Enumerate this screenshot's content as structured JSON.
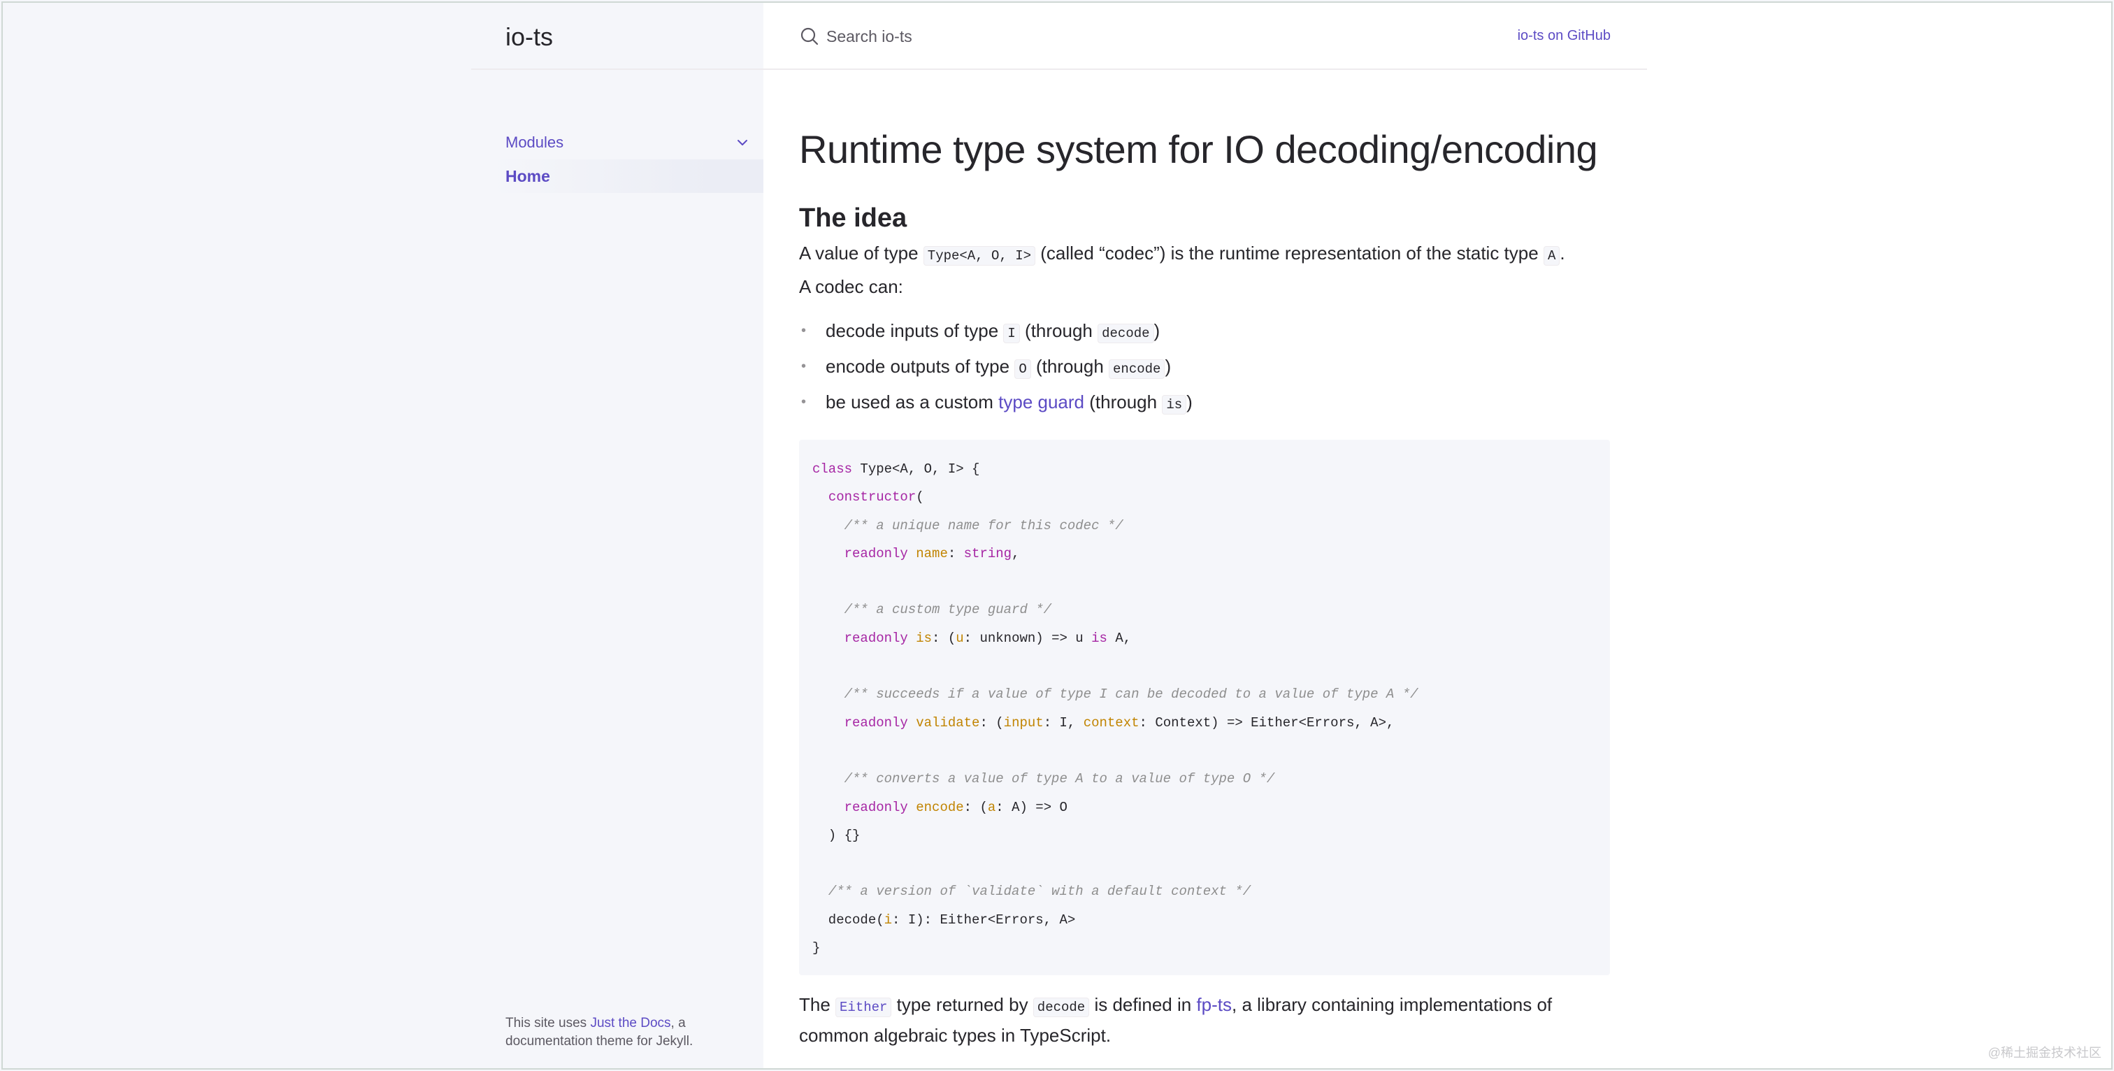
{
  "site": {
    "title": "io-ts"
  },
  "sidebar": {
    "items": [
      {
        "label": "Modules",
        "expanded": true
      },
      {
        "label": "Home",
        "active": true
      }
    ],
    "footer_prefix": "This site uses ",
    "footer_link": "Just the Docs",
    "footer_suffix": ", a documentation theme for Jekyll."
  },
  "header": {
    "search_placeholder": "Search io-ts",
    "github_link": "io-ts on GitHub"
  },
  "main": {
    "title": "Runtime type system for IO decoding/encoding",
    "section_title": "The idea",
    "intro": {
      "t1": "A value of type ",
      "code1": "Type<A, O, I>",
      "t2": " (called “codec”) is the runtime representation of the static type ",
      "code2": "A",
      "t3": "."
    },
    "codec_can": "A codec can:",
    "capabilities": [
      {
        "t1": "decode inputs of type ",
        "code1": "I",
        "t2": " (through ",
        "code2": "decode",
        "t3": ")"
      },
      {
        "t1": "encode outputs of type ",
        "code1": "O",
        "t2": " (through ",
        "code2": "encode",
        "t3": ")"
      },
      {
        "t1": "be used as a custom ",
        "link": "type guard",
        "t2": " (through ",
        "code2": "is",
        "t3": ")"
      }
    ],
    "code_block": [
      [
        {
          "c": "kw",
          "t": "class"
        },
        {
          "c": "pl",
          "t": " Type<A, O, I> {"
        }
      ],
      [
        {
          "c": "pl",
          "t": "  "
        },
        {
          "c": "kw",
          "t": "constructor"
        },
        {
          "c": "pl",
          "t": "("
        }
      ],
      [
        {
          "c": "pl",
          "t": "    "
        },
        {
          "c": "cm",
          "t": "/** a unique name for this codec */"
        }
      ],
      [
        {
          "c": "pl",
          "t": "    "
        },
        {
          "c": "kw",
          "t": "readonly"
        },
        {
          "c": "pl",
          "t": " "
        },
        {
          "c": "prop",
          "t": "name"
        },
        {
          "c": "pl",
          "t": ": "
        },
        {
          "c": "kw",
          "t": "string"
        },
        {
          "c": "pl",
          "t": ","
        }
      ],
      [],
      [
        {
          "c": "pl",
          "t": "    "
        },
        {
          "c": "cm",
          "t": "/** a custom type guard */"
        }
      ],
      [
        {
          "c": "pl",
          "t": "    "
        },
        {
          "c": "kw",
          "t": "readonly"
        },
        {
          "c": "pl",
          "t": " "
        },
        {
          "c": "prop",
          "t": "is"
        },
        {
          "c": "pl",
          "t": ": ("
        },
        {
          "c": "prop",
          "t": "u"
        },
        {
          "c": "pl",
          "t": ": unknown) => u "
        },
        {
          "c": "kw",
          "t": "is"
        },
        {
          "c": "pl",
          "t": " A,"
        }
      ],
      [],
      [
        {
          "c": "pl",
          "t": "    "
        },
        {
          "c": "cm",
          "t": "/** succeeds if a value of type I can be decoded to a value of type A */"
        }
      ],
      [
        {
          "c": "pl",
          "t": "    "
        },
        {
          "c": "kw",
          "t": "readonly"
        },
        {
          "c": "pl",
          "t": " "
        },
        {
          "c": "prop",
          "t": "validate"
        },
        {
          "c": "pl",
          "t": ": ("
        },
        {
          "c": "prop",
          "t": "input"
        },
        {
          "c": "pl",
          "t": ": I, "
        },
        {
          "c": "prop",
          "t": "context"
        },
        {
          "c": "pl",
          "t": ": Context) => Either<Errors, A>,"
        }
      ],
      [],
      [
        {
          "c": "pl",
          "t": "    "
        },
        {
          "c": "cm",
          "t": "/** converts a value of type A to a value of type O */"
        }
      ],
      [
        {
          "c": "pl",
          "t": "    "
        },
        {
          "c": "kw",
          "t": "readonly"
        },
        {
          "c": "pl",
          "t": " "
        },
        {
          "c": "prop",
          "t": "encode"
        },
        {
          "c": "pl",
          "t": ": ("
        },
        {
          "c": "prop",
          "t": "a"
        },
        {
          "c": "pl",
          "t": ": A) => O"
        }
      ],
      [
        {
          "c": "pl",
          "t": "  ) {}"
        }
      ],
      [],
      [
        {
          "c": "pl",
          "t": "  "
        },
        {
          "c": "cm",
          "t": "/** a version of `validate` with a default context */"
        }
      ],
      [
        {
          "c": "pl",
          "t": "  decode("
        },
        {
          "c": "prop",
          "t": "i"
        },
        {
          "c": "pl",
          "t": ": I): Either<Errors, A>"
        }
      ],
      [
        {
          "c": "pl",
          "t": "}"
        }
      ]
    ],
    "bottom": {
      "t1": "The ",
      "code1": "Either",
      "t2": " type returned by ",
      "code2": "decode",
      "t3": " is defined in ",
      "link": "fp-ts",
      "t4": ", a library containing implementations of common algebraic types in TypeScript."
    }
  },
  "watermark": "@稀土掘金技术社区",
  "colors": {
    "link": "#5c4bc4",
    "text": "#27262b",
    "sidebar_bg": "#f5f6fa"
  }
}
